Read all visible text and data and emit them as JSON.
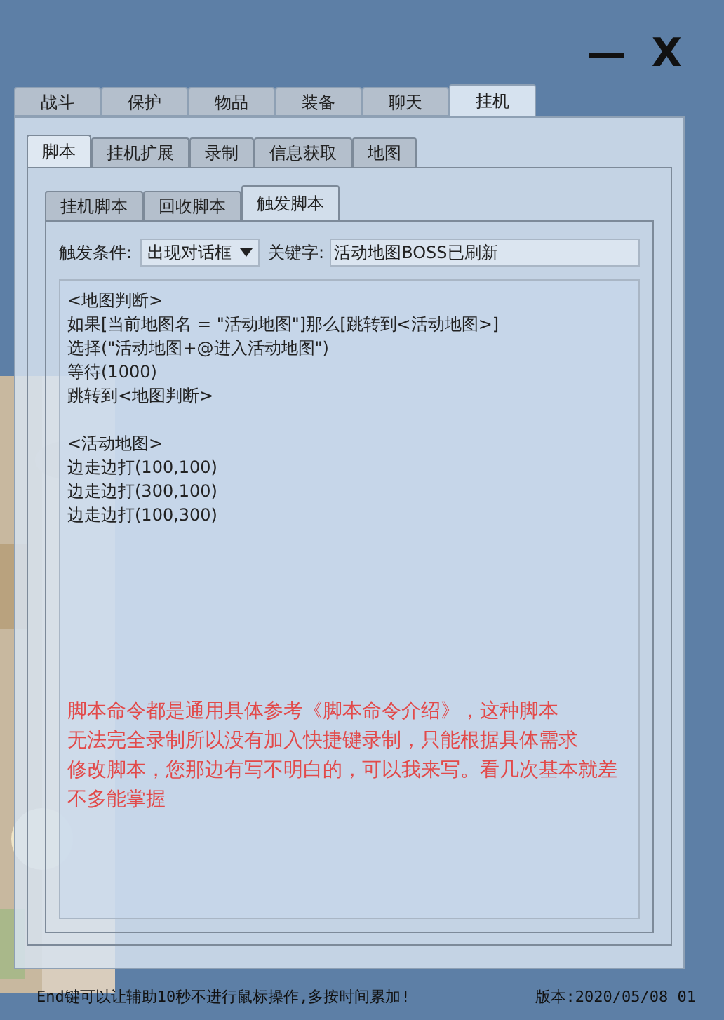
{
  "window_controls": [
    "—",
    "X"
  ],
  "main_tabs": [
    {
      "label": "战斗",
      "selected": false
    },
    {
      "label": "保护",
      "selected": false
    },
    {
      "label": "物品",
      "selected": false
    },
    {
      "label": "装备",
      "selected": false
    },
    {
      "label": "聊天",
      "selected": false
    },
    {
      "label": "挂机",
      "selected": true
    }
  ],
  "sub_tabs": [
    {
      "label": "脚本",
      "selected": true
    },
    {
      "label": "挂机扩展",
      "selected": false
    },
    {
      "label": "录制",
      "selected": false
    },
    {
      "label": "信息获取",
      "selected": false
    },
    {
      "label": "地图",
      "selected": false
    }
  ],
  "script_tabs": [
    {
      "label": "挂机脚本",
      "selected": false
    },
    {
      "label": "回收脚本",
      "selected": false
    },
    {
      "label": "触发脚本",
      "selected": true
    }
  ],
  "trigger": {
    "condition_label": "触发条件:",
    "condition_value": "出现对话框",
    "keyword_label": "关键字:",
    "keyword_value": "活动地图BOSS已刷新"
  },
  "script_blocks": [
    [
      "<地图判断>",
      "如果[当前地图名 = \"活动地图\"]那么[跳转到<活动地图>]",
      "选择(\"活动地图+@进入活动地图\")",
      "等待(1000)",
      "跳转到<地图判断>"
    ],
    [
      "<活动地图>",
      "边走边打(100,100)",
      "边走边打(300,100)",
      "边走边打(100,300)"
    ]
  ],
  "note_lines": [
    "脚本命令都是通用具体参考《脚本命令介绍》，这种脚本",
    "无法完全录制所以没有加入快捷键录制，只能根据具体需求",
    "修改脚本，您那边有写不明白的，可以我来写。看几次基本就差",
    "不多能掌握"
  ],
  "status_bar": {
    "hint": "End键可以让辅助10秒不进行鼠标操作,多按时间累加!",
    "version": "版本:2020/05/08 01"
  }
}
